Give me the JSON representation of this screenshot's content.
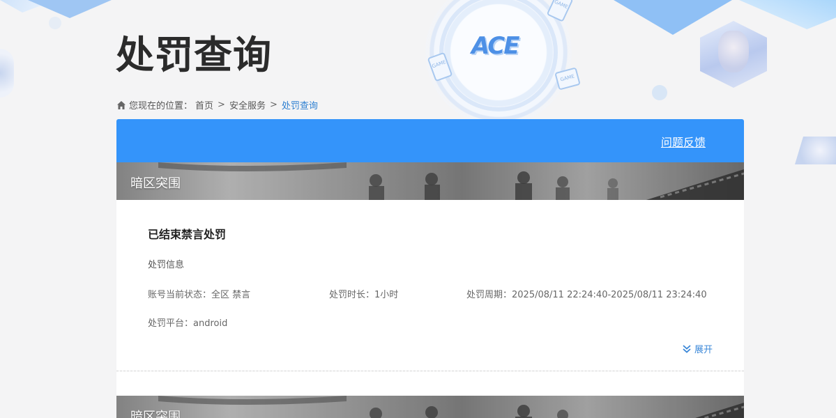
{
  "page": {
    "title": "处罚查询",
    "logo_text": "ACE",
    "deco_tag": "GAME"
  },
  "breadcrumb": {
    "prefix": "您现在的位置：",
    "items": [
      "首页",
      "安全服务",
      "处罚查询"
    ],
    "separator": ">"
  },
  "header_bar": {
    "feedback_label": "问题反馈",
    "color": "#3494fa"
  },
  "records": [
    {
      "game_name": "暗区突围",
      "status_title": "已结束禁言处罚",
      "section_label": "处罚信息",
      "account_status_label": "账号当前状态：",
      "account_status_value": "全区 禁言",
      "duration_label": "处罚时长：",
      "duration_value": "1小时",
      "period_label": "处罚周期：",
      "period_value": "2025/08/11 22:24:40-2025/08/11 23:24:40",
      "platform_label": "处罚平台：",
      "platform_value": "android",
      "expand_label": "展开"
    },
    {
      "game_name": "暗区突围"
    }
  ],
  "icons": {
    "home": "home-icon",
    "expand": "double-chevron-down-icon"
  },
  "colors": {
    "accent": "#3494fa",
    "link": "#2d7fd1"
  }
}
